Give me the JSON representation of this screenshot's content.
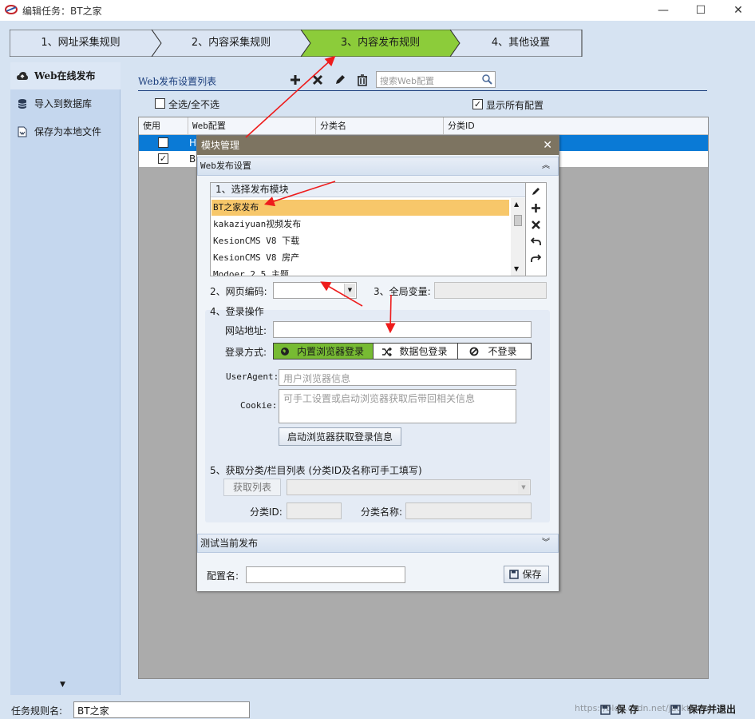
{
  "window": {
    "title": "编辑任务：BT之家",
    "minimize": "—",
    "maximize": "☐",
    "close": "✕"
  },
  "steps": [
    {
      "label": "1、网址采集规则",
      "active": false
    },
    {
      "label": "2、内容采集规则",
      "active": false
    },
    {
      "label": "3、内容发布规则",
      "active": true
    },
    {
      "label": "4、其他设置",
      "active": false
    }
  ],
  "sidebar": {
    "items": [
      {
        "label": "Web在线发布",
        "icon": "cloud-upload-icon",
        "selected": true
      },
      {
        "label": "导入到数据库",
        "icon": "database-icon",
        "selected": false
      },
      {
        "label": "保存为本地文件",
        "icon": "file-icon",
        "selected": false
      }
    ],
    "scroll_down": "▼"
  },
  "list": {
    "title": "Web发布设置列表",
    "search_placeholder": "搜索Web配置",
    "select_all_label": "全选/全不选",
    "show_all_label": "显示所有配置",
    "columns": [
      "使用",
      "Web配置",
      "分类名",
      "分类ID"
    ],
    "rows": [
      {
        "checked": false,
        "config": "H",
        "selected": true
      },
      {
        "checked": true,
        "config": "B",
        "selected": false
      }
    ]
  },
  "modal": {
    "title": "模块管理",
    "section_web": "Web发布设置",
    "module_group_label": "1、选择发布模块",
    "modules": [
      "BT之家发布",
      "kakaziyuan视频发布",
      "KesionCMS V8 下载",
      "KesionCMS V8 房产",
      "Modoer 2.5 主题"
    ],
    "encoding_label": "2、网页编码:",
    "encoding_value": "",
    "global_var_label": "3、全局变量:",
    "login_group_label": "4、登录操作",
    "site_url_label": "网站地址:",
    "site_url_value": "",
    "login_method_label": "登录方式:",
    "login_methods": [
      "内置浏览器登录",
      "数据包登录",
      "不登录"
    ],
    "useragent_label": "UserAgent:",
    "useragent_placeholder": "用户浏览器信息",
    "cookie_label": "Cookie:",
    "cookie_placeholder": "可手工设置或启动浏览器获取后带回相关信息",
    "launch_browser_btn": "启动浏览器获取登录信息",
    "category_group_label": "5、获取分类/栏目列表 (分类ID及名称可手工填写)",
    "get_list_btn": "获取列表",
    "category_id_label": "分类ID:",
    "category_name_label": "分类名称:",
    "test_section": "测试当前发布",
    "config_name_label": "配置名:",
    "config_name_value": "",
    "save_btn": "保存",
    "collapse_glyph": "︽",
    "expand_glyph": "︾"
  },
  "bottom": {
    "task_name_label": "任务规则名:",
    "task_name_value": "BT之家",
    "save_btn": "保 存",
    "save_exit_btn": "保存并退出",
    "watermark": "https://blog.csdn.net/jacktkerer"
  },
  "colors": {
    "active_step": "#8ccc3a",
    "row_selected": "#0a7ad6",
    "modal_title": "#7d7461",
    "module_selected": "#f7c76a",
    "annotation_arrow": "#ee1c1c",
    "segment_active": "#77bb33"
  }
}
